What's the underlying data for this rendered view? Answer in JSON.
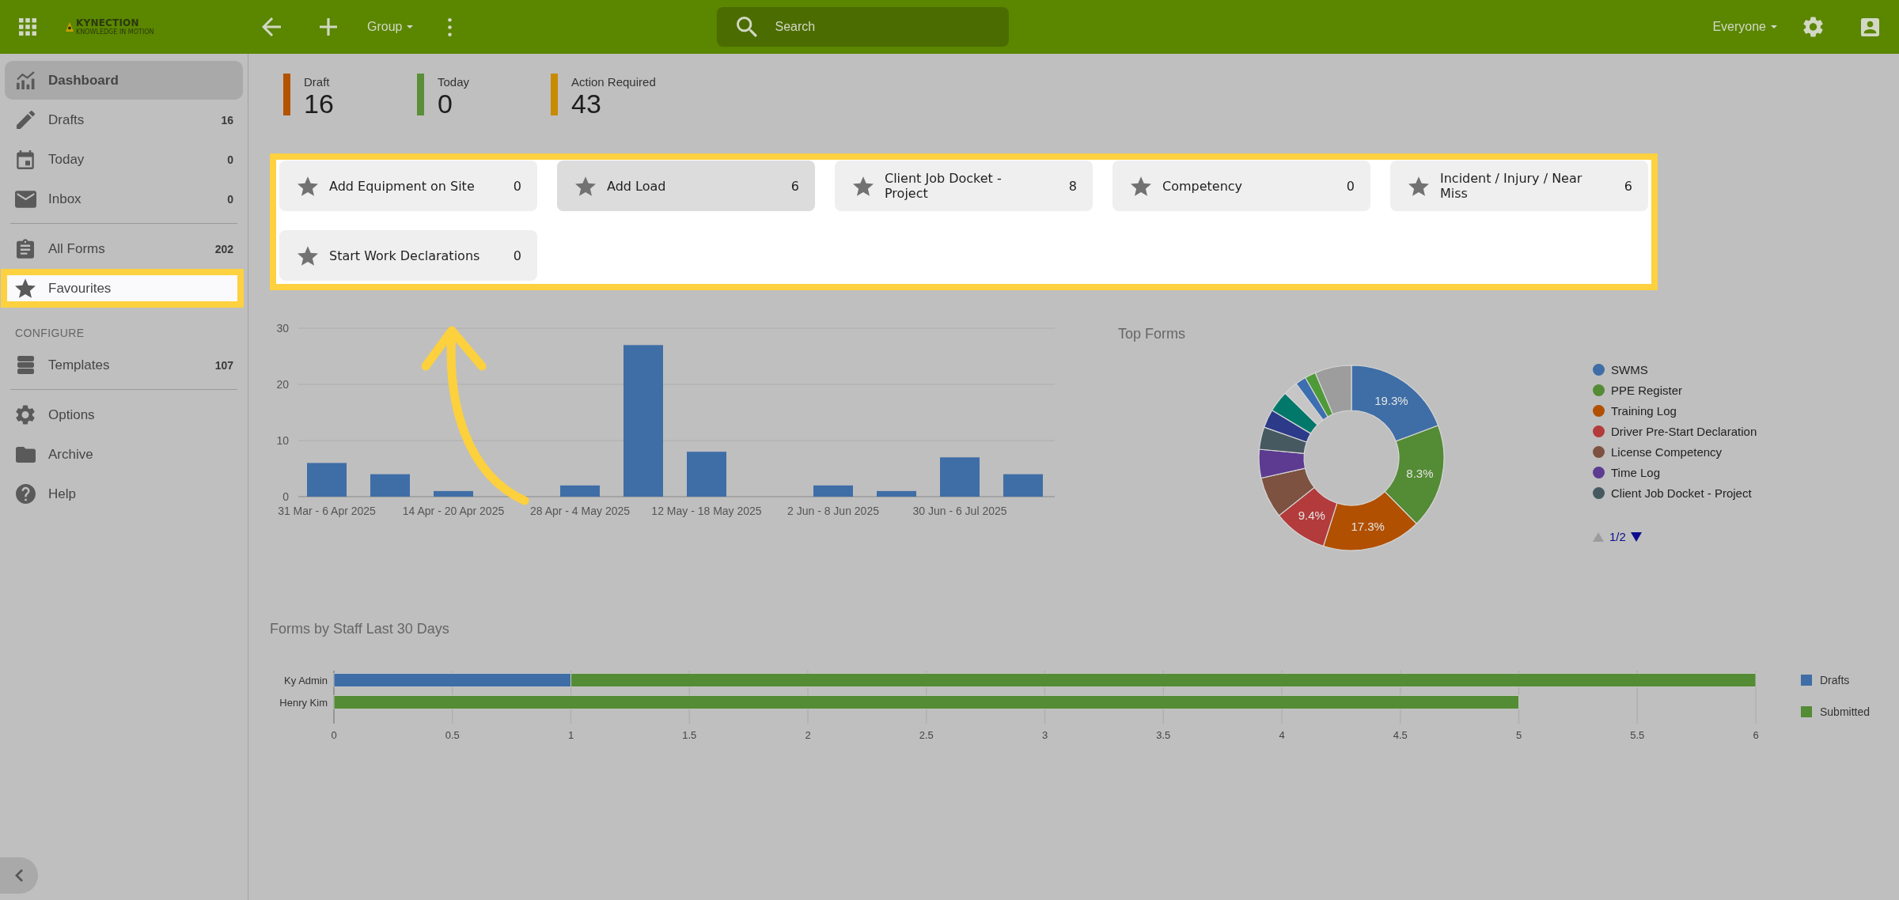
{
  "topbar": {
    "logo": {
      "name": "KYNECTION",
      "tagline": "KNOWLEDGE IN MOTION"
    },
    "group_menu": {
      "label": "Group"
    },
    "search": {
      "placeholder": "Search"
    },
    "scope_menu": {
      "label": "Everyone"
    }
  },
  "sidebar": {
    "items": [
      {
        "kind": "link",
        "label": "Dashboard",
        "selected": true,
        "highlighted": false
      },
      {
        "kind": "link",
        "label": "Drafts",
        "count": "16",
        "selected": false,
        "highlighted": false
      },
      {
        "kind": "link",
        "label": "Today",
        "count": "0",
        "selected": false,
        "highlighted": false
      },
      {
        "kind": "link",
        "label": "Inbox",
        "count": "0",
        "selected": false,
        "highlighted": false
      },
      {
        "kind": "divider"
      },
      {
        "kind": "link",
        "label": "All Forms",
        "count": "202",
        "selected": false,
        "highlighted": false
      },
      {
        "kind": "link",
        "label": "Favourites",
        "selected": false,
        "highlighted": true
      },
      {
        "kind": "heading",
        "label": "CONFIGURE"
      },
      {
        "kind": "link",
        "label": "Templates",
        "count": "107",
        "selected": false,
        "highlighted": false
      },
      {
        "kind": "divider"
      },
      {
        "kind": "link",
        "label": "Options",
        "selected": false,
        "highlighted": false
      },
      {
        "kind": "link",
        "label": "Archive",
        "selected": false,
        "highlighted": false
      },
      {
        "kind": "link",
        "label": "Help",
        "selected": false,
        "highlighted": false
      }
    ]
  },
  "stats": [
    {
      "label": "Draft",
      "value": "16",
      "color": "#b35300"
    },
    {
      "label": "Today",
      "value": "0",
      "color": "#5a8f37"
    },
    {
      "label": "Action Required",
      "value": "43",
      "color": "#c88a00"
    }
  ],
  "favourites": {
    "highlighted": true,
    "pointer_arrow": true,
    "cards": [
      {
        "label": "Add Equipment on Site",
        "count": "0",
        "hovered": false
      },
      {
        "label": "Add Load",
        "count": "6",
        "hovered": true
      },
      {
        "label": "Client Job Docket - Project",
        "count": "8",
        "hovered": false
      },
      {
        "label": "Competency",
        "count": "0",
        "hovered": false
      },
      {
        "label": "Incident / Injury / Near Miss",
        "count": "6",
        "hovered": false
      },
      {
        "label": "Start Work Declarations",
        "count": "0",
        "hovered": false
      }
    ]
  },
  "activity_chart": {
    "chart_data": {
      "type": "bar",
      "categories": [
        "31 Mar - 6 Apr 2025",
        null,
        "14 Apr - 20 Apr 2025",
        null,
        "28 Apr - 4 May 2025",
        null,
        "12 May - 18 May 2025",
        null,
        "2 Jun - 8 Jun 2025",
        null,
        "30 Jun - 6 Jul 2025",
        null
      ],
      "values": [
        6,
        4,
        1,
        0,
        2,
        27,
        8,
        0,
        2,
        1,
        7,
        4
      ],
      "ylim": [
        0,
        30
      ],
      "yticks": [
        0,
        10,
        20,
        30
      ],
      "grid": true
    }
  },
  "top_forms": {
    "chart_data": {
      "type": "donut",
      "title": "Top Forms",
      "values": [
        19.3,
        18.3,
        17.3,
        9.4,
        7.2,
        5.0,
        3.9,
        3.2,
        3.7,
        2.5,
        1.9,
        1.9,
        6.4
      ],
      "colors": [
        "#3f6ea6",
        "#548b35",
        "#b15000",
        "#b33b3b",
        "#7d5241",
        "#5c3b91",
        "#465960",
        "#2c3a8a",
        "#02786a",
        "#c6c6c6",
        "#3d6fb0",
        "#4f9a38",
        "#9d9d9d"
      ]
    },
    "slice_labels": [
      "19.3%",
      "8.3%",
      "17.3%",
      "9.4%"
    ],
    "legend": [
      {
        "label": "SWMS",
        "color": "#3f6ea6"
      },
      {
        "label": "PPE Register",
        "color": "#548b35"
      },
      {
        "label": "Training Log",
        "color": "#b15000"
      },
      {
        "label": "Driver Pre-Start Declaration",
        "color": "#b33b3b"
      },
      {
        "label": "License Competency",
        "color": "#7d5241"
      },
      {
        "label": "Time Log",
        "color": "#5c3b91"
      },
      {
        "label": "Client Job Docket - Project",
        "color": "#465960"
      }
    ],
    "pager": {
      "label": "1/2",
      "prev_enabled": false,
      "next_enabled": true
    }
  },
  "staff_chart": {
    "chart_data": {
      "type": "bar",
      "orientation": "horizontal",
      "stacked": true,
      "grid": true,
      "legend": "right",
      "title": "Forms by Staff Last 30 Days",
      "categories": [
        "Ky Admin",
        "Henry Kim"
      ],
      "series": [
        {
          "name": "Drafts",
          "color": "#3f6ea6",
          "values": [
            1,
            0
          ]
        },
        {
          "name": "Submitted",
          "color": "#548b35",
          "values": [
            5,
            5
          ]
        }
      ],
      "xlim": [
        0,
        6
      ],
      "xticks": [
        0,
        0.5,
        1,
        1.5,
        2,
        2.5,
        3,
        3.5,
        4,
        4.5,
        5,
        5.5,
        6
      ]
    }
  }
}
